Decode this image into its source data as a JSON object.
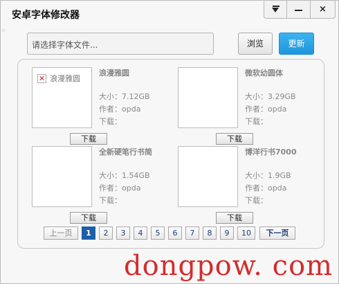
{
  "window": {
    "title": "安卓字体修改器"
  },
  "title_buttons": {
    "menu": "menu",
    "minimize": "minimize",
    "close": "×"
  },
  "toolbar": {
    "file_placeholder": "请选择字体文件...",
    "browse_label": "浏览",
    "update_label": "更新"
  },
  "fonts": [
    {
      "name": "浪漫雅圆",
      "size": "大小：7.12GB",
      "author": "作者：opda",
      "download": "下载：",
      "button": "下载",
      "thumb_alt": "浪漫雅圆",
      "thumb_broken": true
    },
    {
      "name": "微软幼圆体",
      "size": "大小：3.29GB",
      "author": "作者：opda",
      "download": "下载：",
      "button": "下载",
      "thumb_alt": "",
      "thumb_broken": false
    },
    {
      "name": "全新硬笔行书简",
      "size": "大小：1.54GB",
      "author": "作者：opda",
      "download": "下载：",
      "button": "下载",
      "thumb_alt": "",
      "thumb_broken": false
    },
    {
      "name": "博洋行书7000",
      "size": "大小：1.9GB",
      "author": "作者：opda",
      "download": "下载：",
      "button": "下载",
      "thumb_alt": "",
      "thumb_broken": false
    }
  ],
  "pager": {
    "prev": "上一页",
    "next": "下一页",
    "pages": [
      "1",
      "2",
      "3",
      "4",
      "5",
      "6",
      "7",
      "8",
      "9",
      "10"
    ],
    "current": "1"
  },
  "watermark": "dongpow. com",
  "colors": {
    "accent": "#1f96dc",
    "active_page": "#1d5fa6",
    "watermark": "#d42c2c"
  }
}
